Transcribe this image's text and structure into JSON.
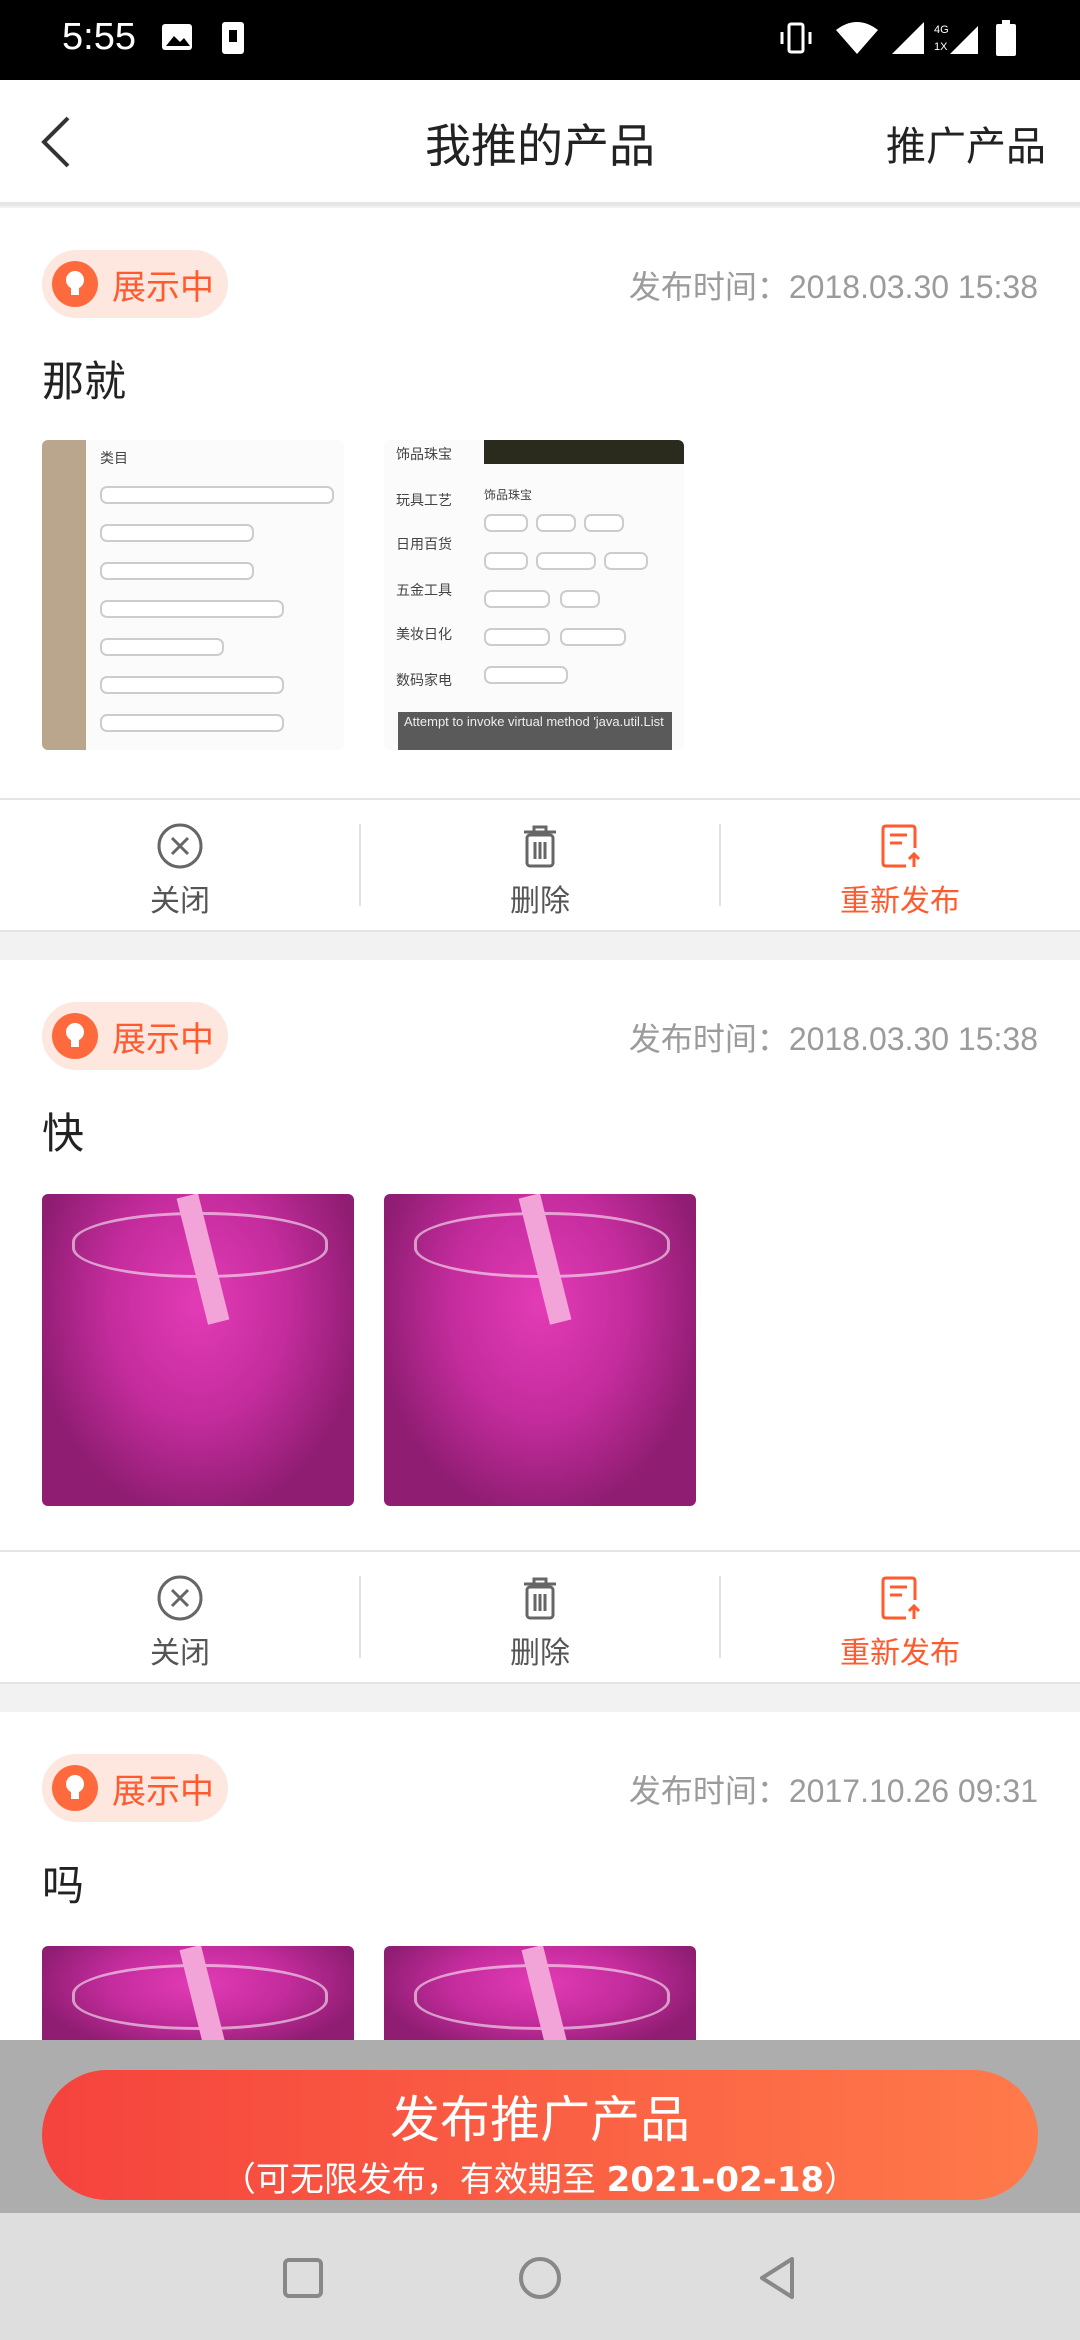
{
  "status_bar": {
    "time": "5:55"
  },
  "header": {
    "title": "我推的产品",
    "right_action": "推广产品"
  },
  "cards": [
    {
      "badge": "展示中",
      "time_label": "发布时间：",
      "time": "2018.03.30 15:38",
      "text": "那就",
      "screenshot_text": {
        "left_header": "类目",
        "categories": [
          "饰品珠宝",
          "玩具工艺",
          "日用百货",
          "五金工具",
          "美妆日化",
          "数码家电"
        ],
        "right_header": "饰品珠宝",
        "error": "Attempt to invoke virtual method 'java.util.List"
      },
      "actions": {
        "close": "关闭",
        "delete": "删除",
        "republish": "重新发布"
      }
    },
    {
      "badge": "展示中",
      "time_label": "发布时间：",
      "time": "2018.03.30 15:38",
      "text": "快",
      "actions": {
        "close": "关闭",
        "delete": "删除",
        "republish": "重新发布"
      }
    },
    {
      "badge": "展示中",
      "time_label": "发布时间：",
      "time": "2017.10.26 09:31",
      "text": "吗"
    }
  ],
  "publish_button": {
    "label": "发布推广产品",
    "note_prefix": "（可无限发布，有效期至 ",
    "note_date": "2021-02-18",
    "note_suffix": "）"
  },
  "colors": {
    "accent": "#ff5b2e",
    "badge_bg": "#fde7df",
    "button_start": "#f5433d",
    "button_end": "#ff7a4a"
  }
}
